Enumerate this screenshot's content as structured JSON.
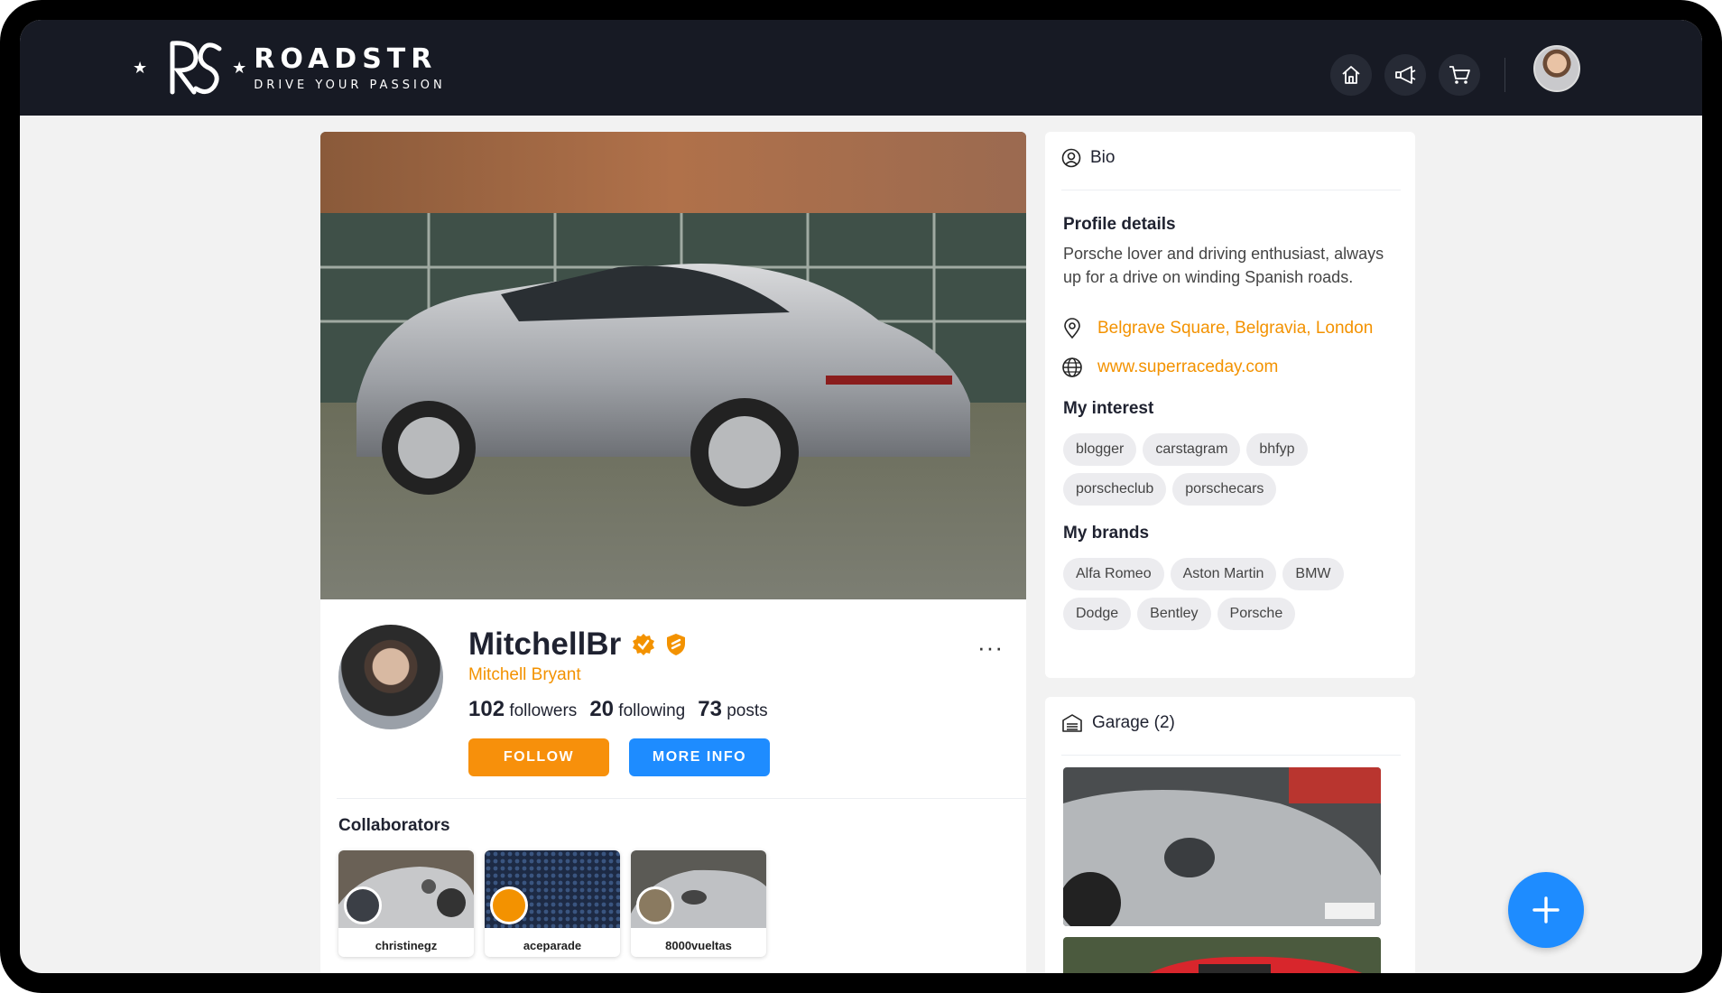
{
  "header": {
    "brand_name": "ROADSTR",
    "tagline": "DRIVE YOUR PASSION",
    "logo_monogram": "RS",
    "nav_icons": [
      "home-icon",
      "megaphone-icon",
      "cart-icon"
    ]
  },
  "profile": {
    "username": "MitchellBr",
    "full_name": "Mitchell Bryant",
    "followers_count": "102",
    "followers_label": "followers",
    "following_count": "20",
    "following_label": "following",
    "posts_count": "73",
    "posts_label": "posts",
    "follow_label": "FOLLOW",
    "more_info_label": "MORE INFO",
    "menu_label": "···"
  },
  "collaborators": {
    "title": "Collaborators",
    "items": [
      {
        "name": "christinegz"
      },
      {
        "name": "aceparade"
      },
      {
        "name": "8000vueltas"
      }
    ]
  },
  "bio": {
    "header": "Bio",
    "details_title": "Profile details",
    "details_text": "Porsche lover and driving enthusiast, always up for a drive on winding Spanish roads.",
    "location": "Belgrave Square, Belgravia, London",
    "website": "www.superraceday.com",
    "interests_title": "My interest",
    "interests": [
      "blogger",
      "carstagram",
      "bhfyp",
      "porscheclub",
      "porschecars"
    ],
    "brands_title": "My brands",
    "brands": [
      "Alfa Romeo",
      "Aston Martin",
      "BMW",
      "Dodge",
      "Bentley",
      "Porsche"
    ]
  },
  "garage": {
    "header": "Garage (2)"
  },
  "colors": {
    "topbar": "#171a24",
    "accent_orange": "#f7900b",
    "accent_blue": "#1e8cff",
    "link_orange": "#f39200"
  }
}
